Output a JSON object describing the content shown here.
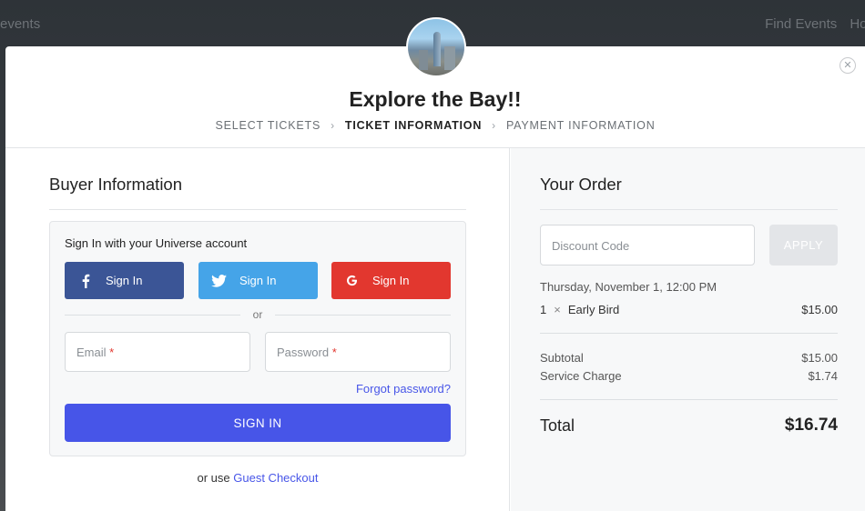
{
  "background": {
    "nav_left": "events",
    "nav_right": [
      "Find Events",
      "Hos"
    ]
  },
  "event": {
    "title": "Explore the Bay!!"
  },
  "steps": [
    "SELECT TICKETS",
    "TICKET INFORMATION",
    "PAYMENT INFORMATION"
  ],
  "steps_active": "TICKET INFORMATION",
  "buyer": {
    "title": "Buyer Information",
    "signin_heading": "Sign In with your Universe account",
    "facebook_label": "Sign In",
    "twitter_label": "Sign In",
    "google_label": "Sign In",
    "or_label": "or",
    "email_placeholder": "Email",
    "password_placeholder": "Password",
    "required_mark": "*",
    "forgot_label": "Forgot password?",
    "signin_button": "SIGN IN",
    "guest_prefix": "or use",
    "guest_link": "Guest Checkout"
  },
  "order": {
    "title": "Your Order",
    "discount_placeholder": "Discount Code",
    "apply_label": "APPLY",
    "date": "Thursday, November 1, 12:00 PM",
    "item_qty": "1",
    "item_times": "×",
    "item_name": "Early Bird",
    "item_price": "$15.00",
    "subtotal_label": "Subtotal",
    "subtotal_value": "$15.00",
    "service_label": "Service Charge",
    "service_value": "$1.74",
    "total_label": "Total",
    "total_value": "$16.74"
  },
  "colors": {
    "primary": "#4755e8",
    "facebook": "#3b5596",
    "twitter": "#45a4e8",
    "google": "#e2372f",
    "required": "#e2372f"
  },
  "icons": [
    "facebook-icon",
    "twitter-icon",
    "google-icon",
    "close-icon"
  ]
}
